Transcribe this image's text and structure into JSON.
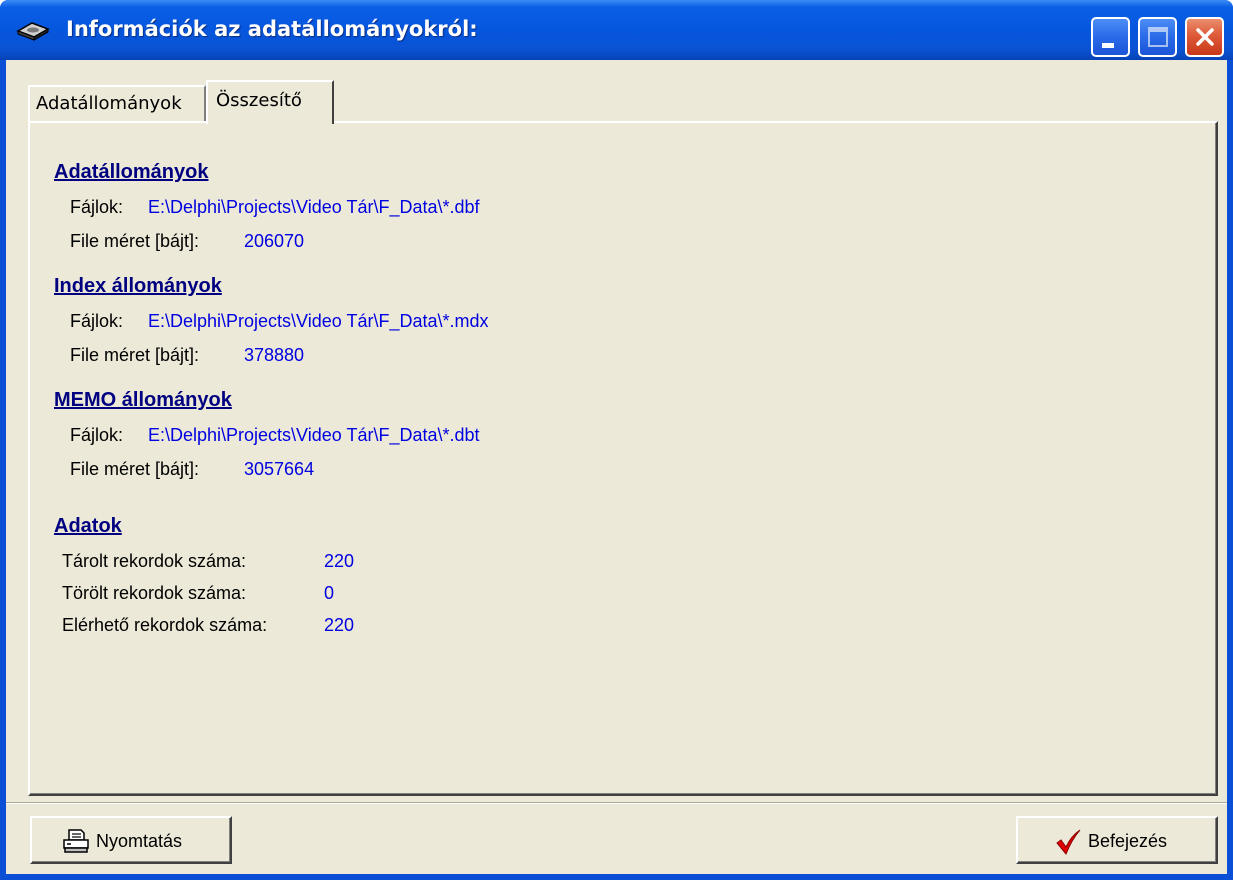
{
  "window": {
    "title": "Információk az adatállományokról:",
    "icon": "disk-drive-icon",
    "buttons": [
      "minimize-icon",
      "maximize-icon",
      "close-icon"
    ]
  },
  "tabs": [
    {
      "label": "Adatállományok",
      "active": false
    },
    {
      "label": "Összesítő",
      "active": true
    }
  ],
  "sections": {
    "data_files": {
      "title": "Adatállományok",
      "files_label": "Fájlok:",
      "files_value": "E:\\Delphi\\Projects\\Video Tár\\F_Data\\*.dbf",
      "size_label": "File méret [bájt]:",
      "size_value": "206070"
    },
    "index_files": {
      "title": "Index állományok",
      "files_label": "Fájlok:",
      "files_value": "E:\\Delphi\\Projects\\Video Tár\\F_Data\\*.mdx",
      "size_label": "File méret [bájt]:",
      "size_value": "378880"
    },
    "memo_files": {
      "title": "MEMO állományok",
      "files_label": "Fájlok:",
      "files_value": "E:\\Delphi\\Projects\\Video Tár\\F_Data\\*.dbt",
      "size_label": "File méret [bájt]:",
      "size_value": "3057664"
    },
    "data": {
      "title": "Adatok",
      "stored_label": "Tárolt rekordok száma:",
      "stored_value": "220",
      "deleted_label": "Törölt rekordok száma:",
      "deleted_value": "0",
      "available_label": "Elérhető rekordok száma:",
      "available_value": "220"
    }
  },
  "footer": {
    "print_label": "Nyomtatás",
    "print_icon": "printer-icon",
    "finish_label": "Befejezés",
    "finish_icon": "checkmark-icon"
  },
  "colors": {
    "titlebar": "#0656de",
    "face": "#ece9d8",
    "section_title": "#000080",
    "value_text": "#0000e0",
    "checkmark": "#e00000"
  }
}
